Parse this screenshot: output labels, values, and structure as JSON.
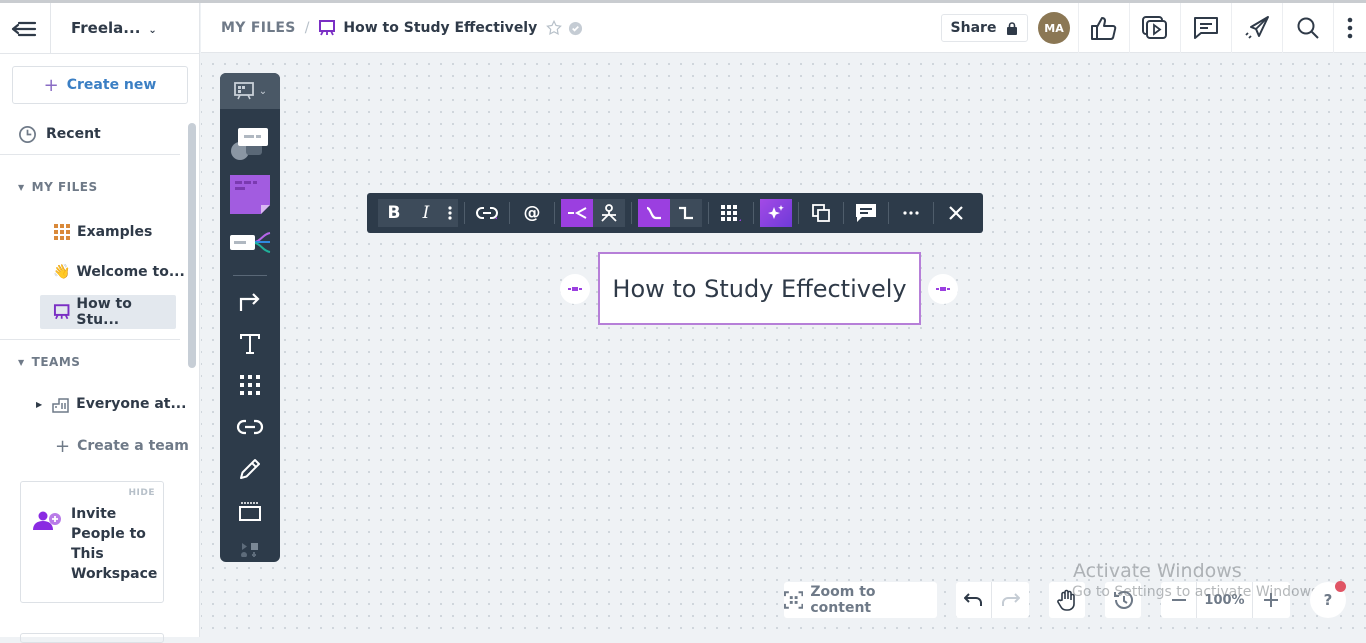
{
  "sidebar": {
    "workspace": "Freela...",
    "create_new": "Create new",
    "recent": "Recent",
    "my_files": {
      "heading": "MY FILES",
      "items": [
        {
          "label": "Examples",
          "icon": "grid-icon"
        },
        {
          "label": "Welcome to...",
          "icon": "waving-hand-icon"
        },
        {
          "label": "How to Stu...",
          "icon": "presentation-icon",
          "selected": true
        }
      ]
    },
    "teams": {
      "heading": "TEAMS",
      "items": [
        {
          "label": "Everyone at...",
          "icon": "building-icon"
        }
      ],
      "create_team": "Create a team"
    },
    "invite": {
      "hide": "HIDE",
      "text": "Invite People to This Workspace"
    }
  },
  "header": {
    "breadcrumb_root": "MY FILES",
    "separator": "/",
    "title": "How to Study Effectively",
    "share": "Share",
    "avatar_initials": "MA",
    "avatar_color": "#8b7754"
  },
  "format_toolbar": {
    "bold": "B",
    "italic": "I"
  },
  "canvas": {
    "node_text": "How to Study Effectively",
    "accent_color": "#9b3fe0"
  },
  "bottom_bar": {
    "zoom_to_content": "Zoom to content",
    "zoom_level": "100%",
    "help": "?"
  },
  "watermark": {
    "line1": "Activate Windows",
    "line2": "Go to Settings to activate Windows."
  }
}
